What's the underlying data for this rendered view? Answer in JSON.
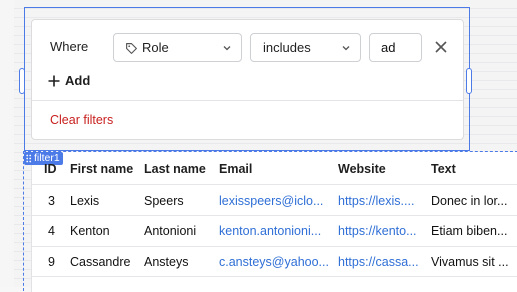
{
  "filter": {
    "where_label": "Where",
    "field": "Role",
    "operator": "includes",
    "value": "ad",
    "add_label": "Add",
    "clear_label": "Clear filters",
    "widget_badge": "filter1"
  },
  "table": {
    "columns": [
      "ID",
      "First name",
      "Last name",
      "Email",
      "Website",
      "Text"
    ],
    "rows": [
      [
        "3",
        "Lexis",
        "Speers",
        "lexisspeers@iclo...",
        "https://lexis....",
        "Donec in lor..."
      ],
      [
        "4",
        "Kenton",
        "Antonioni",
        "kenton.antonioni...",
        "https://kento...",
        "Etiam biben..."
      ],
      [
        "9",
        "Cassandre",
        "Ansteys",
        "c.ansteys@yahoo...",
        "https://cassa...",
        "Vivamus sit ..."
      ]
    ]
  }
}
